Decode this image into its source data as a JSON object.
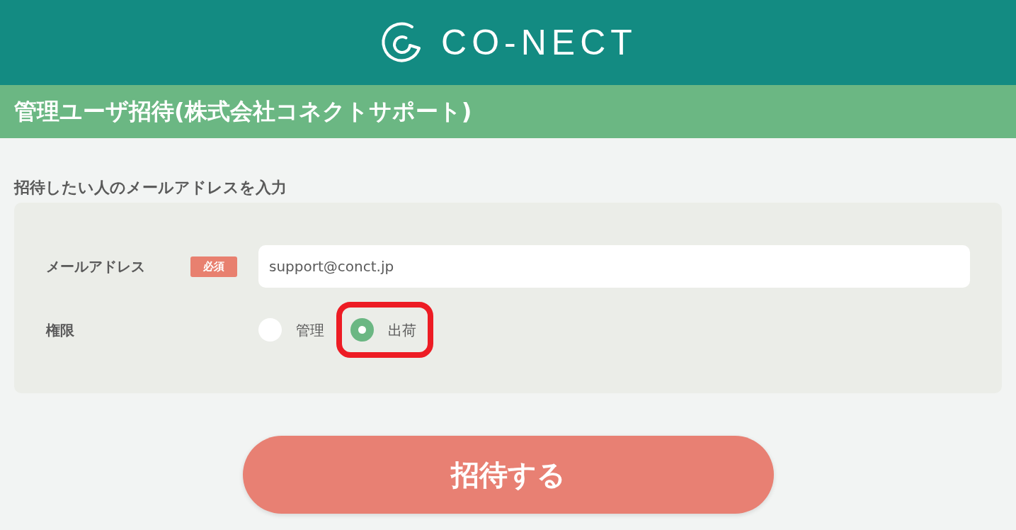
{
  "header": {
    "logo_text": "CO-NECT"
  },
  "title_bar": {
    "title": "管理ユーザ招待(株式会社コネクトサポート)"
  },
  "section": {
    "heading": "招待したい人のメールアドレスを入力"
  },
  "form": {
    "email": {
      "label": "メールアドレス",
      "badge": "必須",
      "value": "support@conct.jp"
    },
    "permission": {
      "label": "権限",
      "options": [
        {
          "label": "管理",
          "selected": false,
          "highlighted": false
        },
        {
          "label": "出荷",
          "selected": true,
          "highlighted": true
        }
      ]
    }
  },
  "submit_button": {
    "label": "招待する"
  }
}
